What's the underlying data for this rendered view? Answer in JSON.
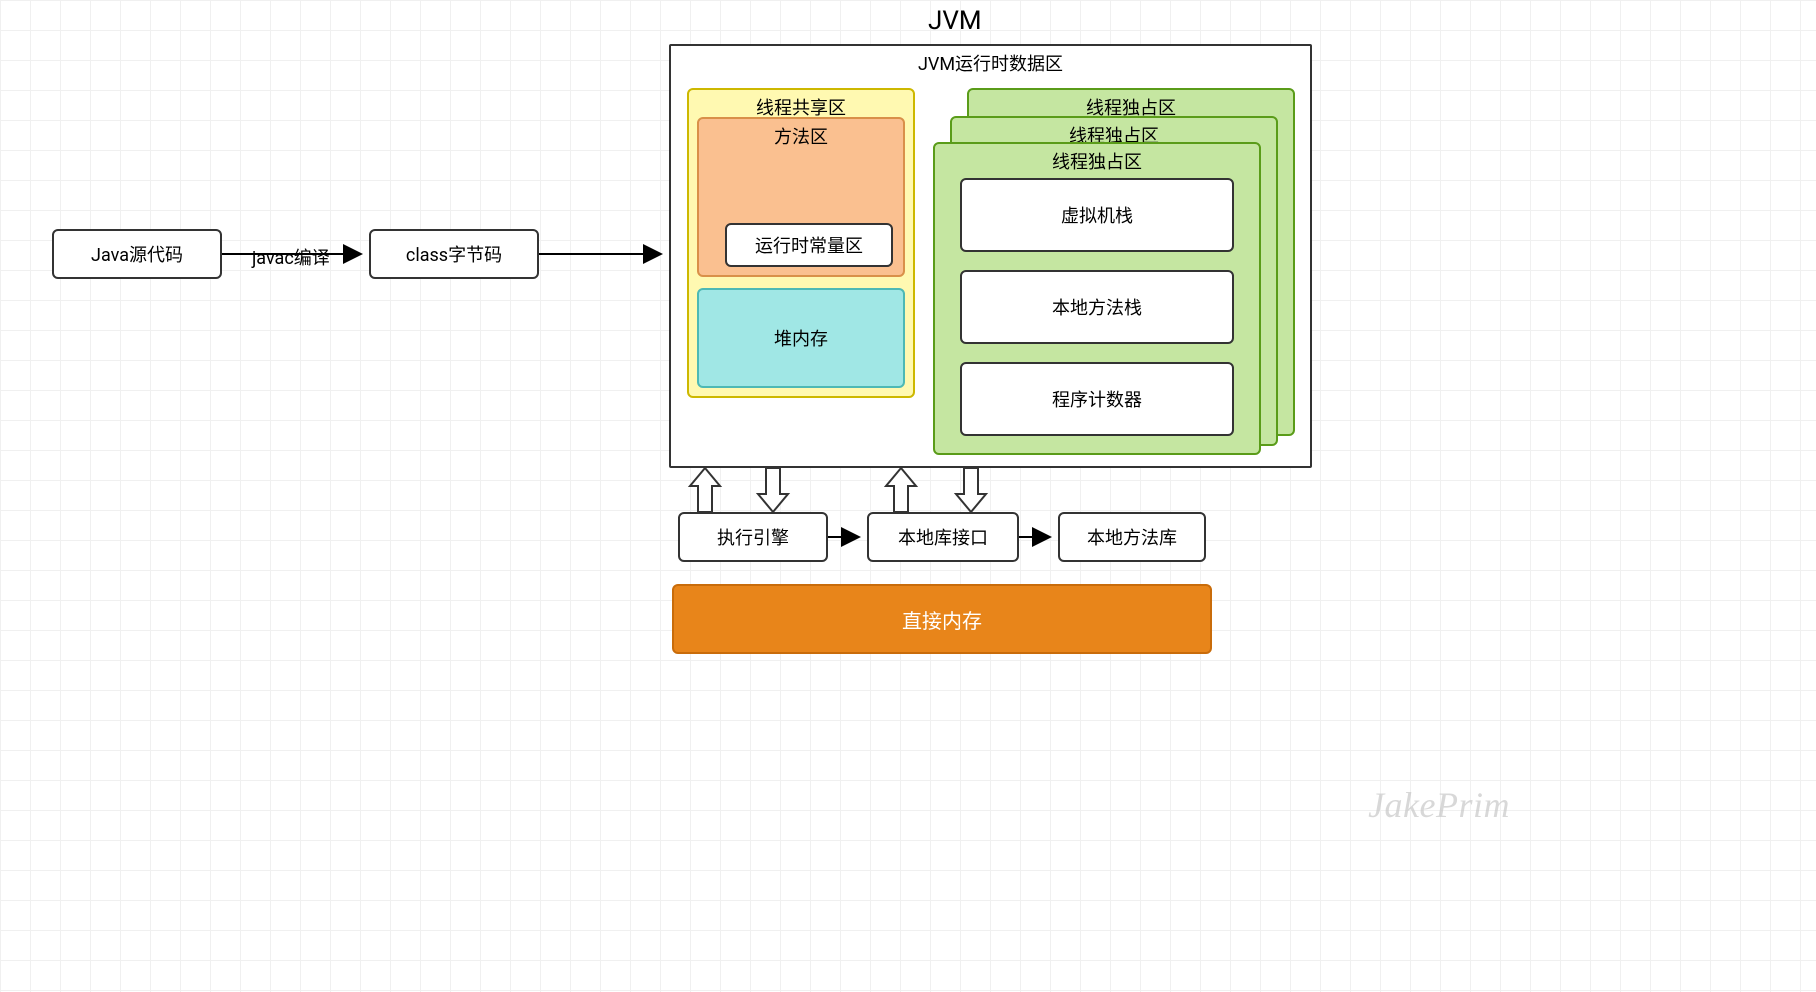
{
  "title": "JVM",
  "left": {
    "source": "Java源代码",
    "edge_label": "javac编译",
    "bytecode": "class字节码"
  },
  "runtime": {
    "title": "JVM运行时数据区",
    "shared": {
      "title": "线程共享区",
      "method_area": "方法区",
      "constant_pool": "运行时常量区",
      "heap": "堆内存"
    },
    "private": {
      "title": "线程独占区",
      "stack": "虚拟机栈",
      "native_stack": "本地方法栈",
      "pc": "程序计数器"
    }
  },
  "bottom": {
    "engine": "执行引擎",
    "native_interface": "本地库接口",
    "native_lib": "本地方法库",
    "direct_mem": "直接内存"
  },
  "watermark": "JakePrim"
}
